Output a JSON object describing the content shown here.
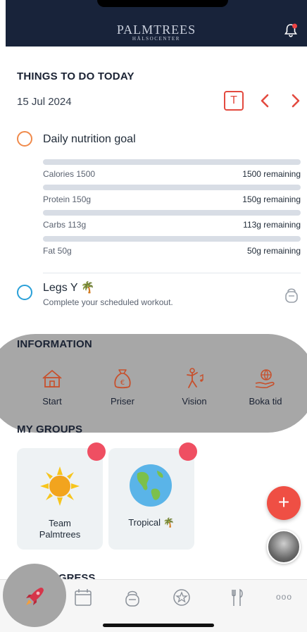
{
  "header": {
    "brand_name": "PALMTREES",
    "brand_sub": "HÄLSOCENTER",
    "bell_icon": "bell-icon"
  },
  "today": {
    "title": "THINGS TO DO TODAY",
    "date": "15 Jul 2024",
    "today_button": "T",
    "prev_icon": "chevron-left-icon",
    "next_icon": "chevron-right-icon"
  },
  "nutrition": {
    "title": "Daily nutrition goal",
    "rows": [
      {
        "label": "Calories 1500",
        "remaining": "1500 remaining"
      },
      {
        "label": "Protein 150g",
        "remaining": "150g remaining"
      },
      {
        "label": "Carbs 113g",
        "remaining": "113g remaining"
      },
      {
        "label": "Fat 50g",
        "remaining": "50g remaining"
      }
    ]
  },
  "workout": {
    "title": "Legs Y 🌴",
    "subtitle": "Complete your scheduled workout."
  },
  "information": {
    "title": "INFORMATION",
    "items": [
      {
        "label": "Start",
        "icon": "house-icon"
      },
      {
        "label": "Priser",
        "icon": "money-bag-icon"
      },
      {
        "label": "Vision",
        "icon": "dancer-icon"
      },
      {
        "label": "Boka tid",
        "icon": "globe-hand-icon"
      }
    ]
  },
  "groups": {
    "title": "MY GROUPS",
    "items": [
      {
        "label_line1": "Team",
        "label_line2": "Palmtrees",
        "icon": "sun-icon"
      },
      {
        "label_line1": "Tropical 🌴",
        "label_line2": "",
        "icon": "globe-icon"
      }
    ]
  },
  "fab": {
    "label": "+"
  },
  "progress": {
    "title": "MY PROGRESS"
  },
  "tabbar": {
    "items": [
      "rocket-icon",
      "calendar-icon",
      "kettlebell-icon",
      "star-badge-icon",
      "fork-knife-icon",
      "more-icon"
    ],
    "more_label": "ooo"
  },
  "colors": {
    "accent": "#e34a3f",
    "header_bg": "#18233a",
    "dot": "#ef4f62"
  }
}
